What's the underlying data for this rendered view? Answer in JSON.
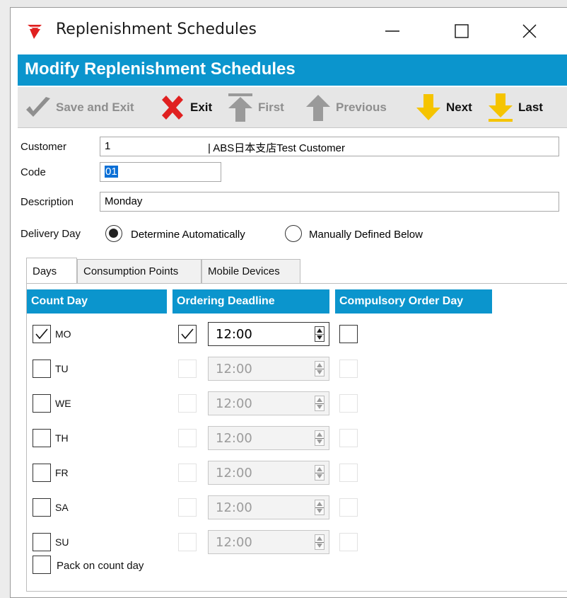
{
  "window": {
    "title": "Replenishment Schedules",
    "controls": {
      "minimize": "minimize",
      "maximize": "maximize",
      "close": "close"
    }
  },
  "header": {
    "title": "Modify Replenishment Schedules"
  },
  "toolbar": {
    "save_exit": "Save and Exit",
    "exit": "Exit",
    "first": "First",
    "previous": "Previous",
    "next": "Next",
    "last": "Last"
  },
  "form": {
    "customer_label": "Customer",
    "customer_code": "1",
    "customer_name": "| ABS日本支店Test Customer",
    "code_label": "Code",
    "code_value": "01",
    "description_label": "Description",
    "description_value": "Monday",
    "delivery_day_label": "Delivery Day",
    "delivery_auto": "Determine Automatically",
    "delivery_manual": "Manually Defined Below",
    "delivery_selected": "auto"
  },
  "tabs": [
    {
      "label": "Days",
      "active": true
    },
    {
      "label": "Consumption Points",
      "active": false
    },
    {
      "label": "Mobile Devices",
      "active": false
    }
  ],
  "columns": {
    "count_day": "Count Day",
    "ordering_deadline": "Ordering Deadline",
    "compulsory": "Compulsory Order Day"
  },
  "days": [
    {
      "label": "MO",
      "count": true,
      "deadline_checked": true,
      "time": "12:00",
      "enabled": true,
      "compulsory": false
    },
    {
      "label": "TU",
      "count": false,
      "deadline_checked": false,
      "time": "12:00",
      "enabled": false,
      "compulsory": false
    },
    {
      "label": "WE",
      "count": false,
      "deadline_checked": false,
      "time": "12:00",
      "enabled": false,
      "compulsory": false
    },
    {
      "label": "TH",
      "count": false,
      "deadline_checked": false,
      "time": "12:00",
      "enabled": false,
      "compulsory": false
    },
    {
      "label": "FR",
      "count": false,
      "deadline_checked": false,
      "time": "12:00",
      "enabled": false,
      "compulsory": false
    },
    {
      "label": "SA",
      "count": false,
      "deadline_checked": false,
      "time": "12:00",
      "enabled": false,
      "compulsory": false
    },
    {
      "label": "SU",
      "count": false,
      "deadline_checked": false,
      "time": "12:00",
      "enabled": false,
      "compulsory": false
    }
  ],
  "pack_on_count_day": {
    "label": "Pack on count day",
    "checked": false
  },
  "colors": {
    "accent": "#0b95cd",
    "warning_yellow": "#f5c400",
    "exit_red": "#e02020"
  }
}
